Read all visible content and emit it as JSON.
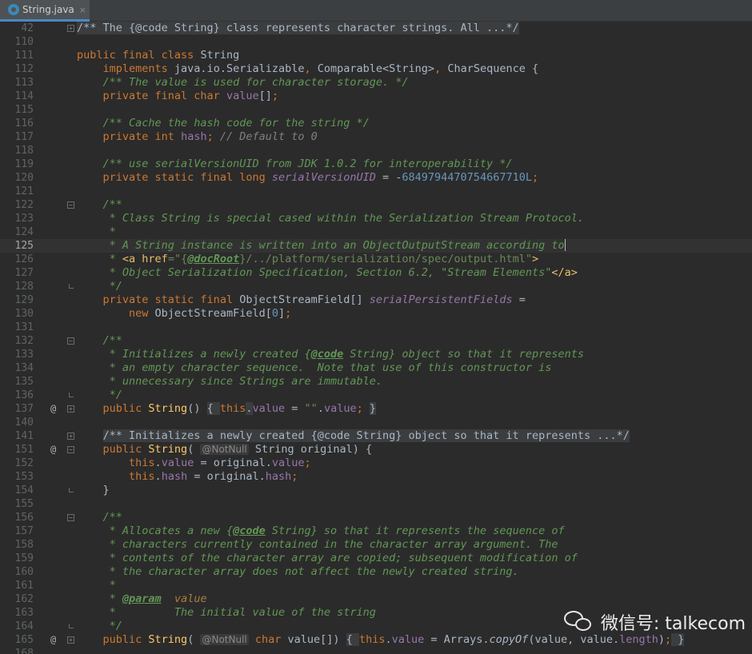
{
  "tab": {
    "label": "String.java",
    "close_glyph": "×",
    "icon": "java-class-icon"
  },
  "editor": {
    "current_line": "125",
    "lines": [
      {
        "n": "42",
        "g": "",
        "f": "plus",
        "s": [
          [
            "t-fcm",
            "/** The {@code String} class represents character strings. All ...*/"
          ]
        ]
      },
      {
        "n": "110",
        "g": "",
        "f": "",
        "s": []
      },
      {
        "n": "111",
        "g": "",
        "f": "",
        "s": [
          [
            "t-kw",
            "public final class "
          ],
          [
            "",
            "String"
          ]
        ]
      },
      {
        "n": "112",
        "g": "",
        "f": "",
        "s": [
          [
            "",
            "    "
          ],
          [
            "t-kw",
            "implements "
          ],
          [
            "",
            "java.io.Serializable"
          ],
          [
            "t-kw",
            ", "
          ],
          [
            "",
            "Comparable<String>"
          ],
          [
            "t-kw",
            ", "
          ],
          [
            "",
            "CharSequence {"
          ]
        ]
      },
      {
        "n": "113",
        "g": "",
        "f": "",
        "s": [
          [
            "",
            "    "
          ],
          [
            "t-cm",
            "/** The value is used for character storage. */"
          ]
        ]
      },
      {
        "n": "114",
        "g": "",
        "f": "",
        "s": [
          [
            "",
            "    "
          ],
          [
            "t-kw",
            "private final char "
          ],
          [
            "t-fd",
            "value"
          ],
          [
            "",
            "[]"
          ],
          [
            "t-kw",
            ";"
          ]
        ]
      },
      {
        "n": "115",
        "g": "",
        "f": "",
        "s": []
      },
      {
        "n": "116",
        "g": "",
        "f": "",
        "s": [
          [
            "",
            "    "
          ],
          [
            "t-cm",
            "/** Cache the hash code for the string */"
          ]
        ]
      },
      {
        "n": "117",
        "g": "",
        "f": "",
        "s": [
          [
            "",
            "    "
          ],
          [
            "t-kw",
            "private int "
          ],
          [
            "t-fd",
            "hash"
          ],
          [
            "t-kw",
            "; "
          ],
          [
            "t-gc",
            "// Default to 0"
          ]
        ]
      },
      {
        "n": "118",
        "g": "",
        "f": "",
        "s": []
      },
      {
        "n": "119",
        "g": "",
        "f": "",
        "s": [
          [
            "",
            "    "
          ],
          [
            "t-cm",
            "/** use serialVersionUID from JDK 1.0.2 for interoperability */"
          ]
        ]
      },
      {
        "n": "120",
        "g": "",
        "f": "",
        "s": [
          [
            "",
            "    "
          ],
          [
            "t-kw",
            "private static final long "
          ],
          [
            "t-sf",
            "serialVersionUID"
          ],
          [
            "",
            " = -"
          ],
          [
            "t-nu",
            "6849794470754667710L"
          ],
          [
            "t-kw",
            ";"
          ]
        ]
      },
      {
        "n": "121",
        "g": "",
        "f": "",
        "s": []
      },
      {
        "n": "122",
        "g": "",
        "f": "minus",
        "s": [
          [
            "",
            "    "
          ],
          [
            "t-cm",
            "/**"
          ]
        ]
      },
      {
        "n": "123",
        "g": "",
        "f": "",
        "s": [
          [
            "",
            "    "
          ],
          [
            "t-cm",
            " * Class String is special cased within the Serialization Stream Protocol."
          ]
        ]
      },
      {
        "n": "124",
        "g": "",
        "f": "",
        "s": [
          [
            "",
            "    "
          ],
          [
            "t-cm",
            " *"
          ]
        ]
      },
      {
        "n": "125",
        "g": "",
        "f": "",
        "s": [
          [
            "",
            "    "
          ],
          [
            "t-cm",
            " * A String instance is written into an ObjectOutputStream according to"
          ],
          [
            "caret",
            ""
          ]
        ]
      },
      {
        "n": "126",
        "g": "",
        "f": "",
        "s": [
          [
            "",
            "    "
          ],
          [
            "t-cm",
            " * "
          ],
          [
            "t-tg",
            "<a href"
          ],
          [
            "t-st",
            "=\"{"
          ],
          [
            "t-tgb",
            "@docRoot"
          ],
          [
            "t-st",
            "}/../platform/serialization/spec/output.html\""
          ],
          [
            "t-tg",
            ">"
          ]
        ]
      },
      {
        "n": "127",
        "g": "",
        "f": "",
        "s": [
          [
            "",
            "    "
          ],
          [
            "t-cm",
            " * Object Serialization Specification, Section 6.2, \"Stream Elements\""
          ],
          [
            "t-tg",
            "</a>"
          ]
        ]
      },
      {
        "n": "128",
        "g": "",
        "f": "end",
        "s": [
          [
            "",
            "    "
          ],
          [
            "t-cm",
            " */"
          ]
        ]
      },
      {
        "n": "129",
        "g": "",
        "f": "",
        "s": [
          [
            "",
            "    "
          ],
          [
            "t-kw",
            "private static final "
          ],
          [
            "",
            "ObjectStreamField[] "
          ],
          [
            "t-sf",
            "serialPersistentFields"
          ],
          [
            "",
            " ="
          ]
        ]
      },
      {
        "n": "130",
        "g": "",
        "f": "",
        "s": [
          [
            "",
            "        "
          ],
          [
            "t-kw",
            "new "
          ],
          [
            "",
            "ObjectStreamField["
          ],
          [
            "t-nu",
            "0"
          ],
          [
            "",
            "]"
          ],
          [
            "t-kw",
            ";"
          ]
        ]
      },
      {
        "n": "131",
        "g": "",
        "f": "",
        "s": []
      },
      {
        "n": "132",
        "g": "",
        "f": "minus",
        "s": [
          [
            "",
            "    "
          ],
          [
            "t-cm",
            "/**"
          ]
        ]
      },
      {
        "n": "133",
        "g": "",
        "f": "",
        "s": [
          [
            "",
            "    "
          ],
          [
            "t-cm",
            " * Initializes a newly created {"
          ],
          [
            "t-tgb",
            "@code"
          ],
          [
            "t-cm",
            " String} object so that it represents"
          ]
        ]
      },
      {
        "n": "134",
        "g": "",
        "f": "",
        "s": [
          [
            "",
            "    "
          ],
          [
            "t-cm",
            " * an empty character sequence.  Note that use of this constructor is"
          ]
        ]
      },
      {
        "n": "135",
        "g": "",
        "f": "",
        "s": [
          [
            "",
            "    "
          ],
          [
            "t-cm",
            " * unnecessary since Strings are immutable."
          ]
        ]
      },
      {
        "n": "136",
        "g": "",
        "f": "end",
        "s": [
          [
            "",
            "    "
          ],
          [
            "t-cm",
            " */"
          ]
        ]
      },
      {
        "n": "137",
        "g": "@",
        "f": "plus",
        "s": [
          [
            "",
            "    "
          ],
          [
            "t-kw",
            "public "
          ],
          [
            "t-fn",
            "String"
          ],
          [
            "",
            "() "
          ],
          [
            "t-fc",
            "{ "
          ],
          [
            "t-kw",
            "this"
          ],
          [
            "t-fc",
            "."
          ],
          [
            "t-fd",
            "value"
          ],
          [
            "",
            " = "
          ],
          [
            "t-st",
            "\"\""
          ],
          [
            "",
            "."
          ],
          [
            "t-fd",
            "value"
          ],
          [
            "t-kw",
            "; "
          ],
          [
            "t-fc",
            "}"
          ]
        ]
      },
      {
        "n": "140",
        "g": "",
        "f": "",
        "s": []
      },
      {
        "n": "141",
        "g": "",
        "f": "plus",
        "s": [
          [
            "",
            "    "
          ],
          [
            "t-fcm",
            "/** Initializes a newly created {@code String} object so that it represents ...*/"
          ]
        ]
      },
      {
        "n": "151",
        "g": "@",
        "f": "minus",
        "s": [
          [
            "",
            "    "
          ],
          [
            "t-kw",
            "public "
          ],
          [
            "t-fn",
            "String"
          ],
          [
            "",
            "( "
          ],
          [
            "t-an",
            "@NotNull"
          ],
          [
            "",
            " String original) {"
          ]
        ]
      },
      {
        "n": "152",
        "g": "",
        "f": "",
        "s": [
          [
            "",
            "        "
          ],
          [
            "t-kw",
            "this"
          ],
          [
            "",
            "."
          ],
          [
            "t-fd",
            "value"
          ],
          [
            "",
            " = original."
          ],
          [
            "t-fd",
            "value"
          ],
          [
            "t-kw",
            ";"
          ]
        ]
      },
      {
        "n": "153",
        "g": "",
        "f": "",
        "s": [
          [
            "",
            "        "
          ],
          [
            "t-kw",
            "this"
          ],
          [
            "",
            "."
          ],
          [
            "t-fd",
            "hash"
          ],
          [
            "",
            " = original."
          ],
          [
            "t-fd",
            "hash"
          ],
          [
            "t-kw",
            ";"
          ]
        ]
      },
      {
        "n": "154",
        "g": "",
        "f": "end",
        "s": [
          [
            "",
            "    }"
          ]
        ]
      },
      {
        "n": "155",
        "g": "",
        "f": "",
        "s": []
      },
      {
        "n": "156",
        "g": "",
        "f": "minus",
        "s": [
          [
            "",
            "    "
          ],
          [
            "t-cm",
            "/**"
          ]
        ]
      },
      {
        "n": "157",
        "g": "",
        "f": "",
        "s": [
          [
            "",
            "    "
          ],
          [
            "t-cm",
            " * Allocates a new {"
          ],
          [
            "t-tgb",
            "@code"
          ],
          [
            "t-cm",
            " String} so that it represents the sequence of"
          ]
        ]
      },
      {
        "n": "158",
        "g": "",
        "f": "",
        "s": [
          [
            "",
            "    "
          ],
          [
            "t-cm",
            " * characters currently contained in the character array argument. The"
          ]
        ]
      },
      {
        "n": "159",
        "g": "",
        "f": "",
        "s": [
          [
            "",
            "    "
          ],
          [
            "t-cm",
            " * contents of the character array are copied; subsequent modification of"
          ]
        ]
      },
      {
        "n": "160",
        "g": "",
        "f": "",
        "s": [
          [
            "",
            "    "
          ],
          [
            "t-cm",
            " * the character array does not affect the newly created string."
          ]
        ]
      },
      {
        "n": "161",
        "g": "",
        "f": "",
        "s": [
          [
            "",
            "    "
          ],
          [
            "t-cm",
            " *"
          ]
        ]
      },
      {
        "n": "162",
        "g": "",
        "f": "",
        "s": [
          [
            "",
            "    "
          ],
          [
            "t-cm",
            " * "
          ],
          [
            "t-tgb",
            "@param"
          ],
          [
            "t-cm",
            "  "
          ],
          [
            "t-pm",
            "value"
          ]
        ]
      },
      {
        "n": "163",
        "g": "",
        "f": "",
        "s": [
          [
            "",
            "    "
          ],
          [
            "t-cm",
            " *         The initial value of the string"
          ]
        ]
      },
      {
        "n": "164",
        "g": "",
        "f": "end",
        "s": [
          [
            "",
            "    "
          ],
          [
            "t-cm",
            " */"
          ]
        ]
      },
      {
        "n": "165",
        "g": "@",
        "f": "plus",
        "s": [
          [
            "",
            "    "
          ],
          [
            "t-kw",
            "public "
          ],
          [
            "t-fn",
            "String"
          ],
          [
            "",
            "( "
          ],
          [
            "t-an",
            "@NotNull"
          ],
          [
            "",
            " "
          ],
          [
            "t-kw",
            "char "
          ],
          [
            "",
            "value[]) "
          ],
          [
            "t-fc",
            "{ "
          ],
          [
            "t-kw",
            "this"
          ],
          [
            "",
            "."
          ],
          [
            "t-fd",
            "value"
          ],
          [
            "",
            " = Arrays."
          ],
          [
            "t-sm",
            "copyOf"
          ],
          [
            "",
            "(value, value."
          ],
          [
            "t-fd",
            "length"
          ],
          [
            "",
            ")"
          ],
          [
            "t-kw",
            ";"
          ],
          [
            "t-fc",
            " }"
          ]
        ]
      },
      {
        "n": "168",
        "g": "",
        "f": "",
        "s": []
      }
    ]
  },
  "watermark": {
    "text": "微信号: talkecom",
    "icon": "wechat-icon"
  }
}
